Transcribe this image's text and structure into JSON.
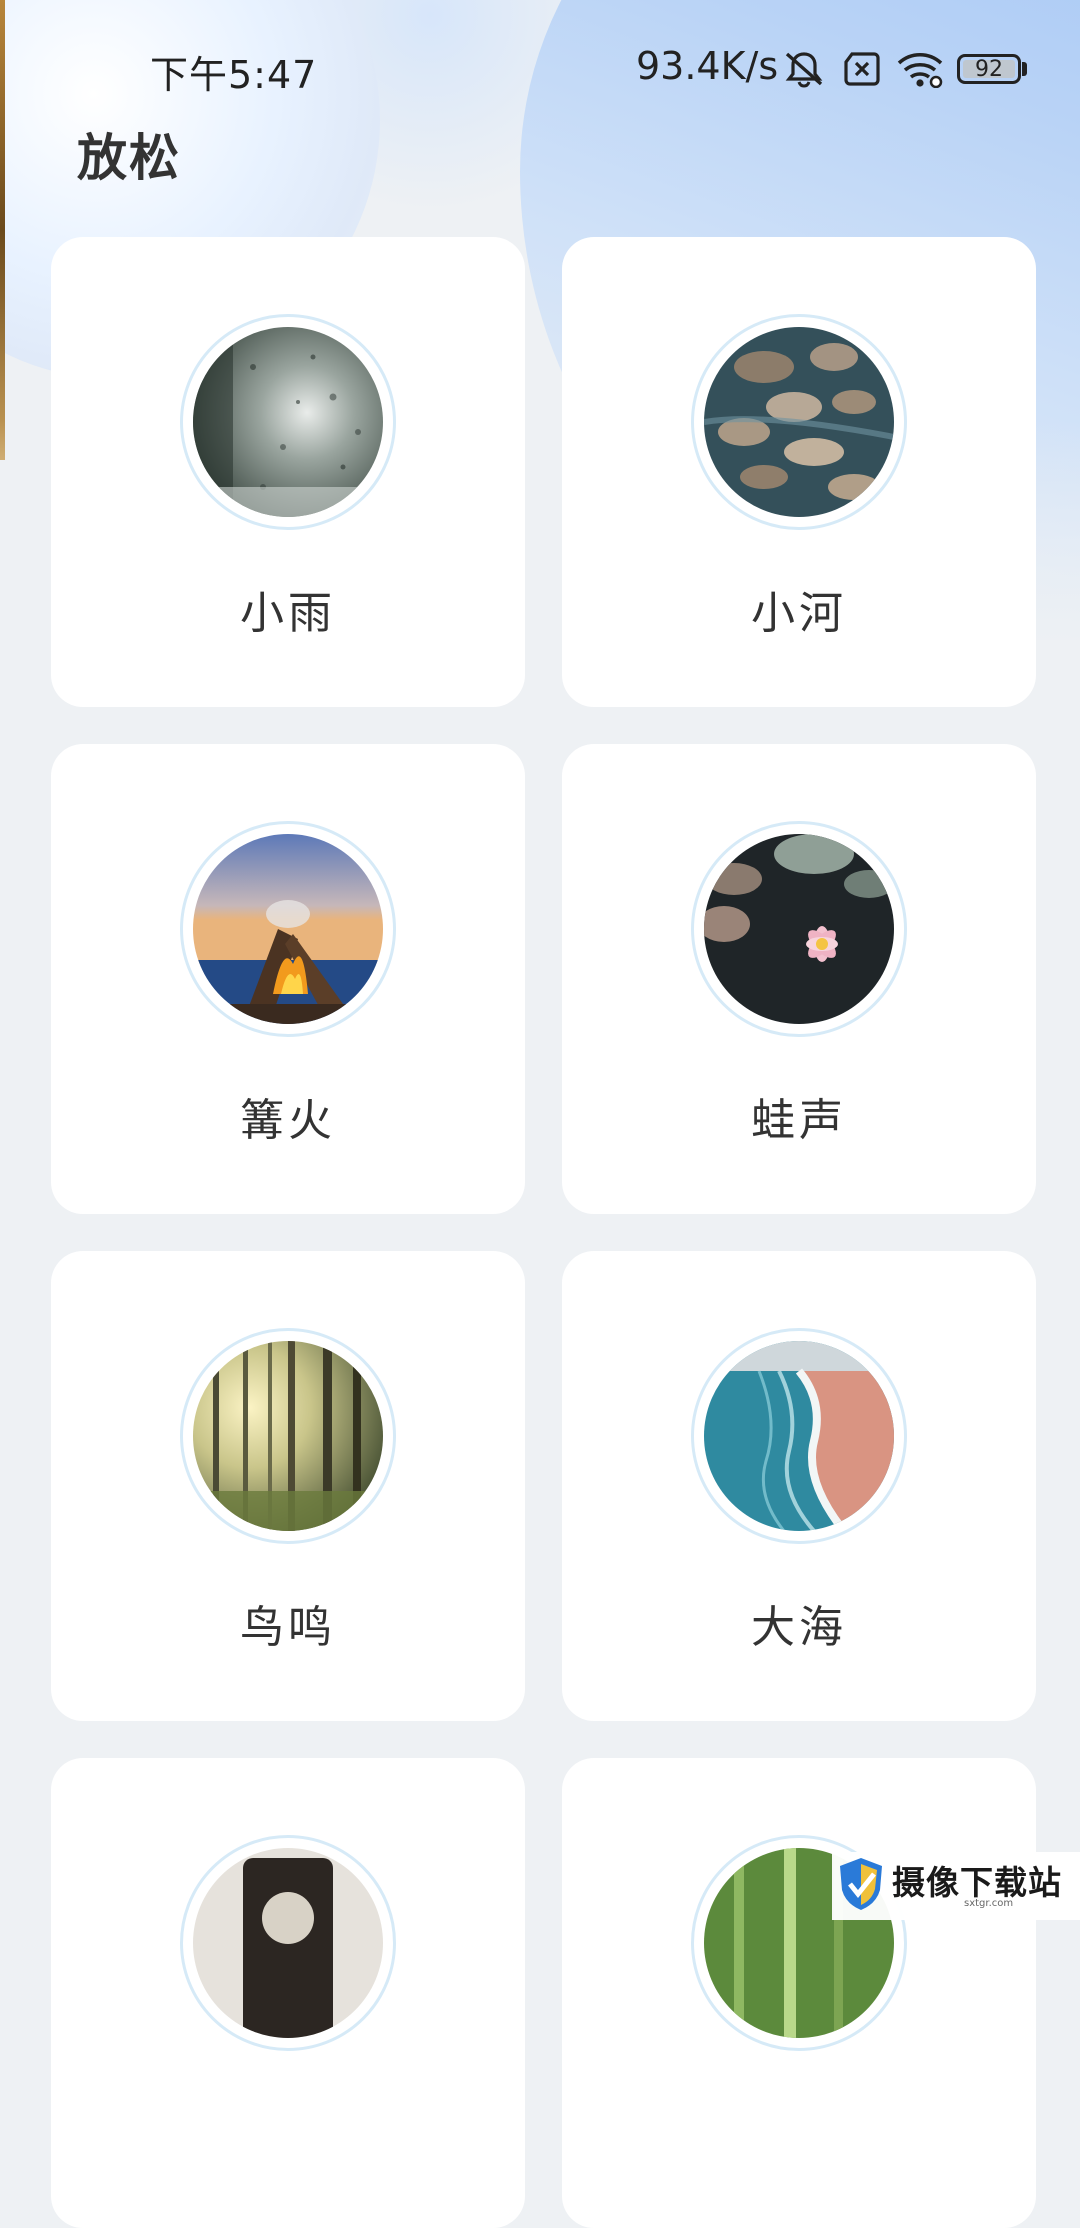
{
  "status_bar": {
    "time": "下午5:47",
    "network_speed": "93.4K/s",
    "battery": "92"
  },
  "page": {
    "title": "放松"
  },
  "sounds": [
    {
      "label": "小雨",
      "image": "rain-window"
    },
    {
      "label": "小河",
      "image": "river-rocks"
    },
    {
      "label": "篝火",
      "image": "campfire"
    },
    {
      "label": "蛙声",
      "image": "lotus-pond"
    },
    {
      "label": "鸟鸣",
      "image": "forest"
    },
    {
      "label": "大海",
      "image": "ocean-beach"
    },
    {
      "label": "",
      "image": "clock"
    },
    {
      "label": "",
      "image": "bamboo"
    }
  ],
  "watermark": {
    "text": "摄像下载站",
    "sub": "sxtgr.com"
  }
}
